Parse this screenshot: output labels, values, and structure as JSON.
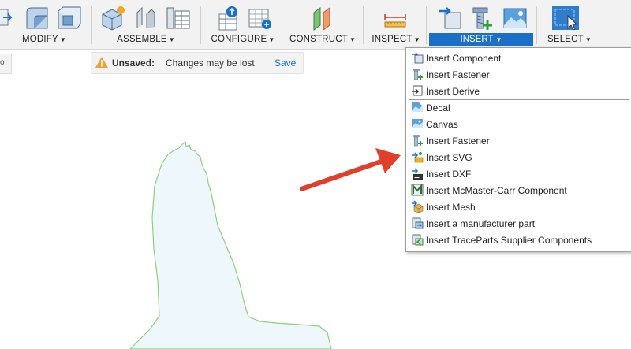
{
  "toolbar": {
    "groups": [
      {
        "label": "MODIFY"
      },
      {
        "label": "ASSEMBLE"
      },
      {
        "label": "CONFIGURE"
      },
      {
        "label": "CONSTRUCT"
      },
      {
        "label": "INSPECT"
      },
      {
        "label": "INSERT"
      },
      {
        "label": "SELECT"
      }
    ],
    "active_group": "INSERT"
  },
  "unsaved_bar": {
    "title": "Unsaved:",
    "message": "Changes may be lost",
    "save_label": "Save"
  },
  "insert_menu": {
    "items": [
      {
        "label": "Insert Component",
        "icon": "insert-component-icon"
      },
      {
        "label": "Insert Fastener",
        "icon": "fastener-icon"
      },
      {
        "label": "Insert Derive",
        "icon": "derive-icon"
      },
      {
        "label": "Decal",
        "icon": "decal-icon"
      },
      {
        "label": "Canvas",
        "icon": "canvas-icon"
      },
      {
        "label": "Insert Fastener",
        "icon": "fastener-icon"
      },
      {
        "label": "Insert SVG",
        "icon": "svg-icon"
      },
      {
        "label": "Insert DXF",
        "icon": "dxf-icon"
      },
      {
        "label": "Insert McMaster-Carr Component",
        "icon": "mcmaster-icon"
      },
      {
        "label": "Insert Mesh",
        "icon": "mesh-icon"
      },
      {
        "label": "Insert a manufacturer part",
        "icon": "manufacturer-part-icon"
      },
      {
        "label": "Insert TraceParts Supplier Components",
        "icon": "traceparts-icon"
      }
    ]
  },
  "colors": {
    "accent": "#1b6fc7",
    "annotation_arrow": "#e0402a",
    "sketch_outline": "#8fcf7a",
    "sketch_fill": "#eef7fc",
    "warning": "#f0a030"
  }
}
